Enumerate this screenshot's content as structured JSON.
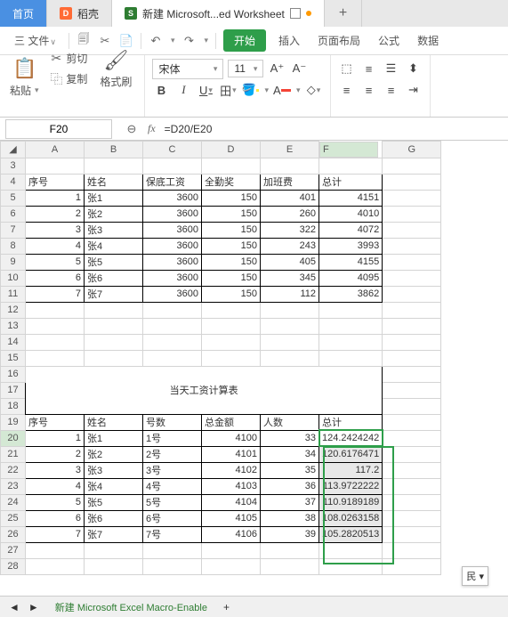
{
  "tabs": {
    "home": "首页",
    "daoke": "稻壳",
    "doc": "新建 Microsoft...ed Worksheet"
  },
  "menu": {
    "file": "三 文件",
    "start": "开始",
    "insert": "插入",
    "layout": "页面布局",
    "formula": "公式",
    "data": "数据"
  },
  "clip": {
    "cut": "剪切",
    "copy": "复制",
    "paste": "粘贴",
    "format": "格式刷"
  },
  "font": {
    "name": "宋体",
    "size": "11"
  },
  "cellref": "F20",
  "formula_text": "=D20/E20",
  "cols": [
    "A",
    "B",
    "C",
    "D",
    "E",
    "F",
    "G"
  ],
  "table1": {
    "header": [
      "序号",
      "姓名",
      "保底工资",
      "全勤奖",
      "加班费",
      "总计"
    ],
    "rows": [
      [
        "1",
        "张1",
        "3600",
        "150",
        "401",
        "4151"
      ],
      [
        "2",
        "张2",
        "3600",
        "150",
        "260",
        "4010"
      ],
      [
        "3",
        "张3",
        "3600",
        "150",
        "322",
        "4072"
      ],
      [
        "4",
        "张4",
        "3600",
        "150",
        "243",
        "3993"
      ],
      [
        "5",
        "张5",
        "3600",
        "150",
        "405",
        "4155"
      ],
      [
        "6",
        "张6",
        "3600",
        "150",
        "345",
        "4095"
      ],
      [
        "7",
        "张7",
        "3600",
        "150",
        "112",
        "3862"
      ]
    ]
  },
  "t2title": "当天工资计算表",
  "table2": {
    "header": [
      "序号",
      "姓名",
      "号数",
      "总金额",
      "人数",
      "总计"
    ],
    "rows": [
      [
        "1",
        "张1",
        "1号",
        "4100",
        "33",
        "124.2424242"
      ],
      [
        "2",
        "张2",
        "2号",
        "4101",
        "34",
        "120.6176471"
      ],
      [
        "3",
        "张3",
        "3号",
        "4102",
        "35",
        "117.2"
      ],
      [
        "4",
        "张4",
        "4号",
        "4103",
        "36",
        "113.9722222"
      ],
      [
        "5",
        "张5",
        "5号",
        "4104",
        "37",
        "110.9189189"
      ],
      [
        "6",
        "张6",
        "6号",
        "4105",
        "38",
        "108.0263158"
      ],
      [
        "7",
        "张7",
        "7号",
        "4106",
        "39",
        "105.2820513"
      ]
    ]
  },
  "sheet": "新建 Microsoft Excel Macro-Enable",
  "popup": "民 ▾"
}
